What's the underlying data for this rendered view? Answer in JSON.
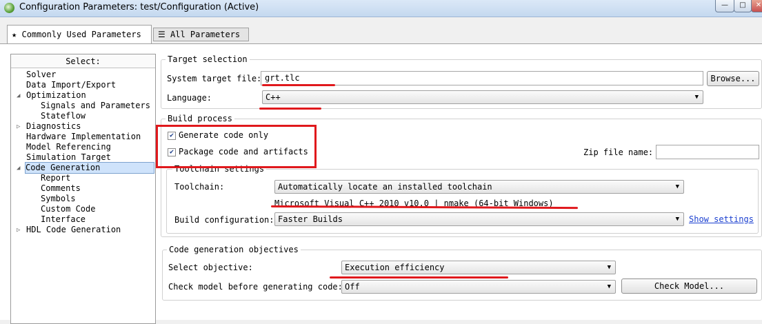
{
  "window": {
    "title": "Configuration Parameters: test/Configuration (Active)",
    "min": "—",
    "max": "□",
    "close": "✕"
  },
  "tabs": [
    {
      "label": "Commonly Used Parameters",
      "icon": "star-icon"
    },
    {
      "label": "All Parameters",
      "icon": "list-icon"
    }
  ],
  "tree": {
    "header": "Select:",
    "items": [
      {
        "label": "Solver",
        "level": 0
      },
      {
        "label": "Data Import/Export",
        "level": 0
      },
      {
        "label": "Optimization",
        "level": 0,
        "expanded": true
      },
      {
        "label": "Signals and Parameters",
        "level": 1
      },
      {
        "label": "Stateflow",
        "level": 1
      },
      {
        "label": "Diagnostics",
        "level": 0,
        "collapsed": true
      },
      {
        "label": "Hardware Implementation",
        "level": 0
      },
      {
        "label": "Model Referencing",
        "level": 0
      },
      {
        "label": "Simulation Target",
        "level": 0
      },
      {
        "label": "Code Generation",
        "level": 0,
        "expanded": true,
        "selected": true
      },
      {
        "label": "Report",
        "level": 1
      },
      {
        "label": "Comments",
        "level": 1
      },
      {
        "label": "Symbols",
        "level": 1
      },
      {
        "label": "Custom Code",
        "level": 1
      },
      {
        "label": "Interface",
        "level": 1
      },
      {
        "label": "HDL Code Generation",
        "level": 0,
        "collapsed": true
      }
    ]
  },
  "target_selection": {
    "legend": "Target selection",
    "system_target_label": "System target file:",
    "system_target_value": "grt.tlc",
    "browse_label": "Browse...",
    "language_label": "Language:",
    "language_value": "C++"
  },
  "build_process": {
    "legend": "Build process",
    "generate_code_only": "Generate code only",
    "package_code": "Package code and artifacts",
    "zip_label": "Zip file name:",
    "zip_value": "",
    "toolchain_legend": "Toolchain settings",
    "toolchain_label": "Toolchain:",
    "toolchain_value": "Automatically locate an installed toolchain",
    "toolchain_info": "Microsoft Visual C++ 2010 v10.0 | nmake (64-bit Windows)",
    "build_config_label": "Build configuration:",
    "build_config_value": "Faster Builds",
    "show_settings": "Show settings"
  },
  "objectives": {
    "legend": "Code generation objectives",
    "select_label": "Select objective:",
    "select_value": "Execution efficiency",
    "check_label": "Check model before generating code:",
    "check_value": "Off",
    "check_button": "Check Model..."
  },
  "annotation_color": "#e0181c"
}
